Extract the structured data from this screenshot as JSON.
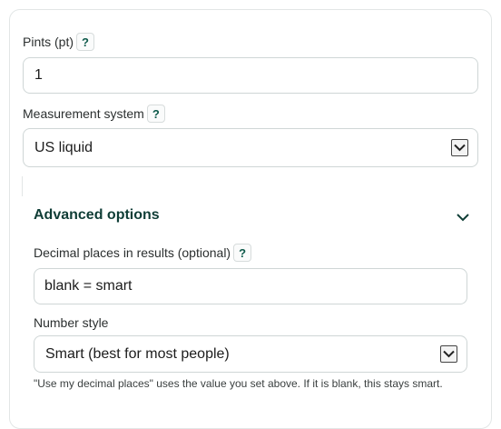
{
  "fields": {
    "pints": {
      "label": "Pints (pt)",
      "help": "?",
      "value": "1"
    },
    "measurement_system": {
      "label": "Measurement system",
      "help": "?",
      "selected": "US liquid"
    }
  },
  "advanced": {
    "title": "Advanced options",
    "decimal_places": {
      "label": "Decimal places in results (optional)",
      "help": "?",
      "placeholder": "blank = smart"
    },
    "number_style": {
      "label": "Number style",
      "selected": "Smart (best for most people)",
      "hint": "\"Use my decimal places\" uses the value you set above. If it is blank, this stays smart."
    }
  },
  "colors": {
    "accent": "#0f3d36",
    "border": "#cfd6d6"
  },
  "icons": {
    "help": "question-mark",
    "select": "chevron-down-icon",
    "expand": "chevron-down-icon"
  }
}
